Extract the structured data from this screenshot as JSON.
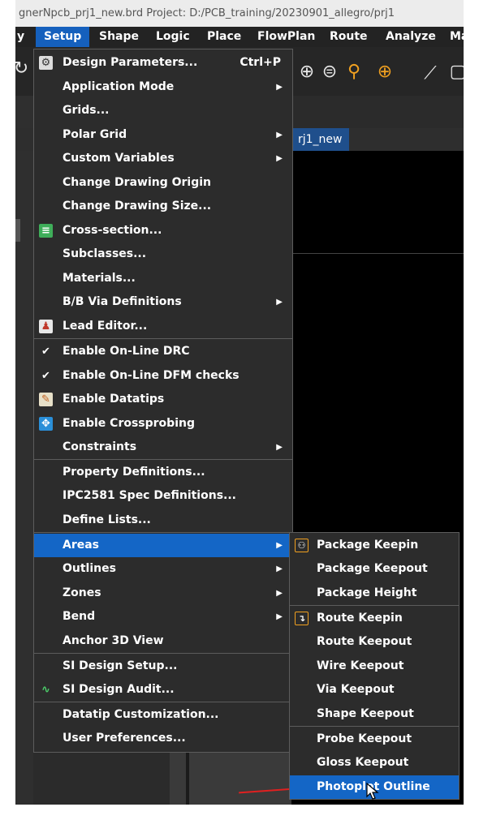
{
  "window": {
    "title": "gnerNpcb_prj1_new.brd  Project: D:/PCB_training/20230901_allegro/prj1"
  },
  "menubar": {
    "items": [
      "y",
      "Setup",
      "Shape",
      "Logic",
      "Place",
      "FlowPlan",
      "Route",
      "Analyze",
      "Ma"
    ]
  },
  "tab": {
    "label": "rj1_new"
  },
  "setup_menu": {
    "design_parameters": "Design Parameters...",
    "design_parameters_shortcut": "Ctrl+P",
    "application_mode": "Application Mode",
    "grids": "Grids...",
    "polar_grid": "Polar Grid",
    "custom_variables": "Custom Variables",
    "change_drawing_origin": "Change Drawing Origin",
    "change_drawing_size": "Change Drawing Size...",
    "cross_section": "Cross-section...",
    "subclasses": "Subclasses...",
    "materials": "Materials...",
    "bb_via_definitions": "B/B Via Definitions",
    "lead_editor": "Lead Editor...",
    "enable_online_drc": "Enable On-Line DRC",
    "enable_online_dfm": "Enable On-Line DFM checks",
    "enable_datatips": "Enable Datatips",
    "enable_crossprobing": "Enable Crossprobing",
    "constraints": "Constraints",
    "property_definitions": "Property Definitions...",
    "ipc2581": "IPC2581 Spec Definitions...",
    "define_lists": "Define Lists...",
    "areas": "Areas",
    "outlines": "Outlines",
    "zones": "Zones",
    "bend": "Bend",
    "anchor_3d_view": "Anchor 3D View",
    "si_design_setup": "SI Design Setup...",
    "si_design_audit": "SI Design Audit...",
    "datatip_customization": "Datatip Customization...",
    "user_preferences": "User Preferences..."
  },
  "areas_submenu": {
    "package_keepin": "Package Keepin",
    "package_keepout": "Package Keepout",
    "package_height": "Package Height",
    "route_keepin": "Route Keepin",
    "route_keepout": "Route Keepout",
    "wire_keepout": "Wire Keepout",
    "via_keepout": "Via Keepout",
    "shape_keepout": "Shape Keepout",
    "probe_keepout": "Probe Keepout",
    "gloss_keepout": "Gloss Keepout",
    "photoplot_outline": "Photoplot Outline"
  },
  "icons": {
    "check": "✔",
    "arrow": "▶"
  },
  "colors": {
    "highlight": "#1466c6",
    "menu_bg": "#2c2c2c",
    "accent_orange": "#f0a020"
  }
}
